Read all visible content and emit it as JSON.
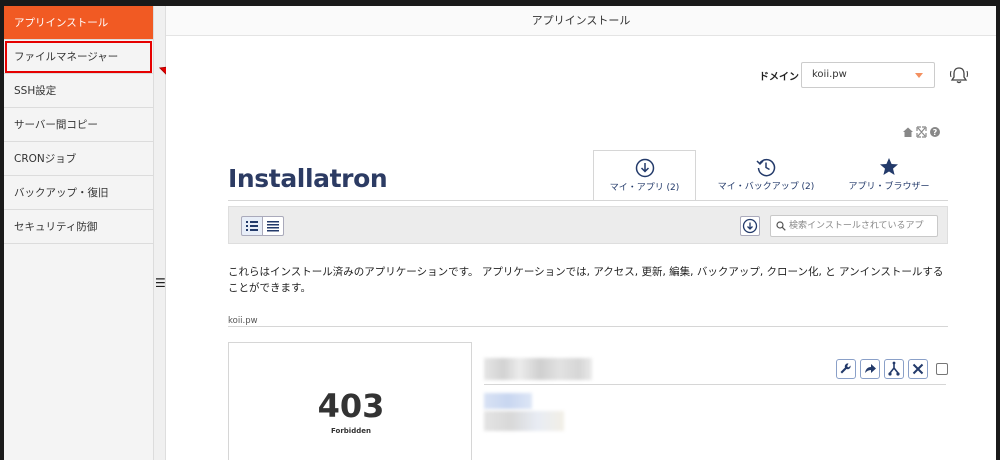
{
  "sidebar": {
    "items": [
      {
        "label": "アプリインストール",
        "active": true
      },
      {
        "label": "ファイルマネージャー",
        "highlighted": true
      },
      {
        "label": "SSH設定"
      },
      {
        "label": "サーバー間コピー"
      },
      {
        "label": "CRONジョブ"
      },
      {
        "label": "バックアップ・復旧"
      },
      {
        "label": "セキュリティ防御"
      }
    ]
  },
  "main": {
    "title": "アプリインストール",
    "domain": {
      "label": "ドメイン",
      "value": "koii.pw"
    },
    "logo": "Installatron",
    "tabs": [
      {
        "label": "マイ・アプリ (2)",
        "icon": "download-circle-icon",
        "active": true
      },
      {
        "label": "マイ・バックアップ (2)",
        "icon": "clock-history-icon"
      },
      {
        "label": "アプリ・ブラウザー",
        "icon": "star-icon"
      }
    ],
    "search": {
      "placeholder": "検索インストールされているアプ"
    },
    "description": "これらはインストール済みのアプリケーションです。 アプリケーションでは, アクセス, 更新, 編集, バックアップ, クローン化, と アンインストールすることができます。",
    "section_label": "koii.pw",
    "app_card": {
      "code": "403",
      "text": "Forbidden"
    }
  },
  "colors": {
    "accent": "#f15a23",
    "highlight_box": "#e60000",
    "link_blue": "#233a6a"
  }
}
